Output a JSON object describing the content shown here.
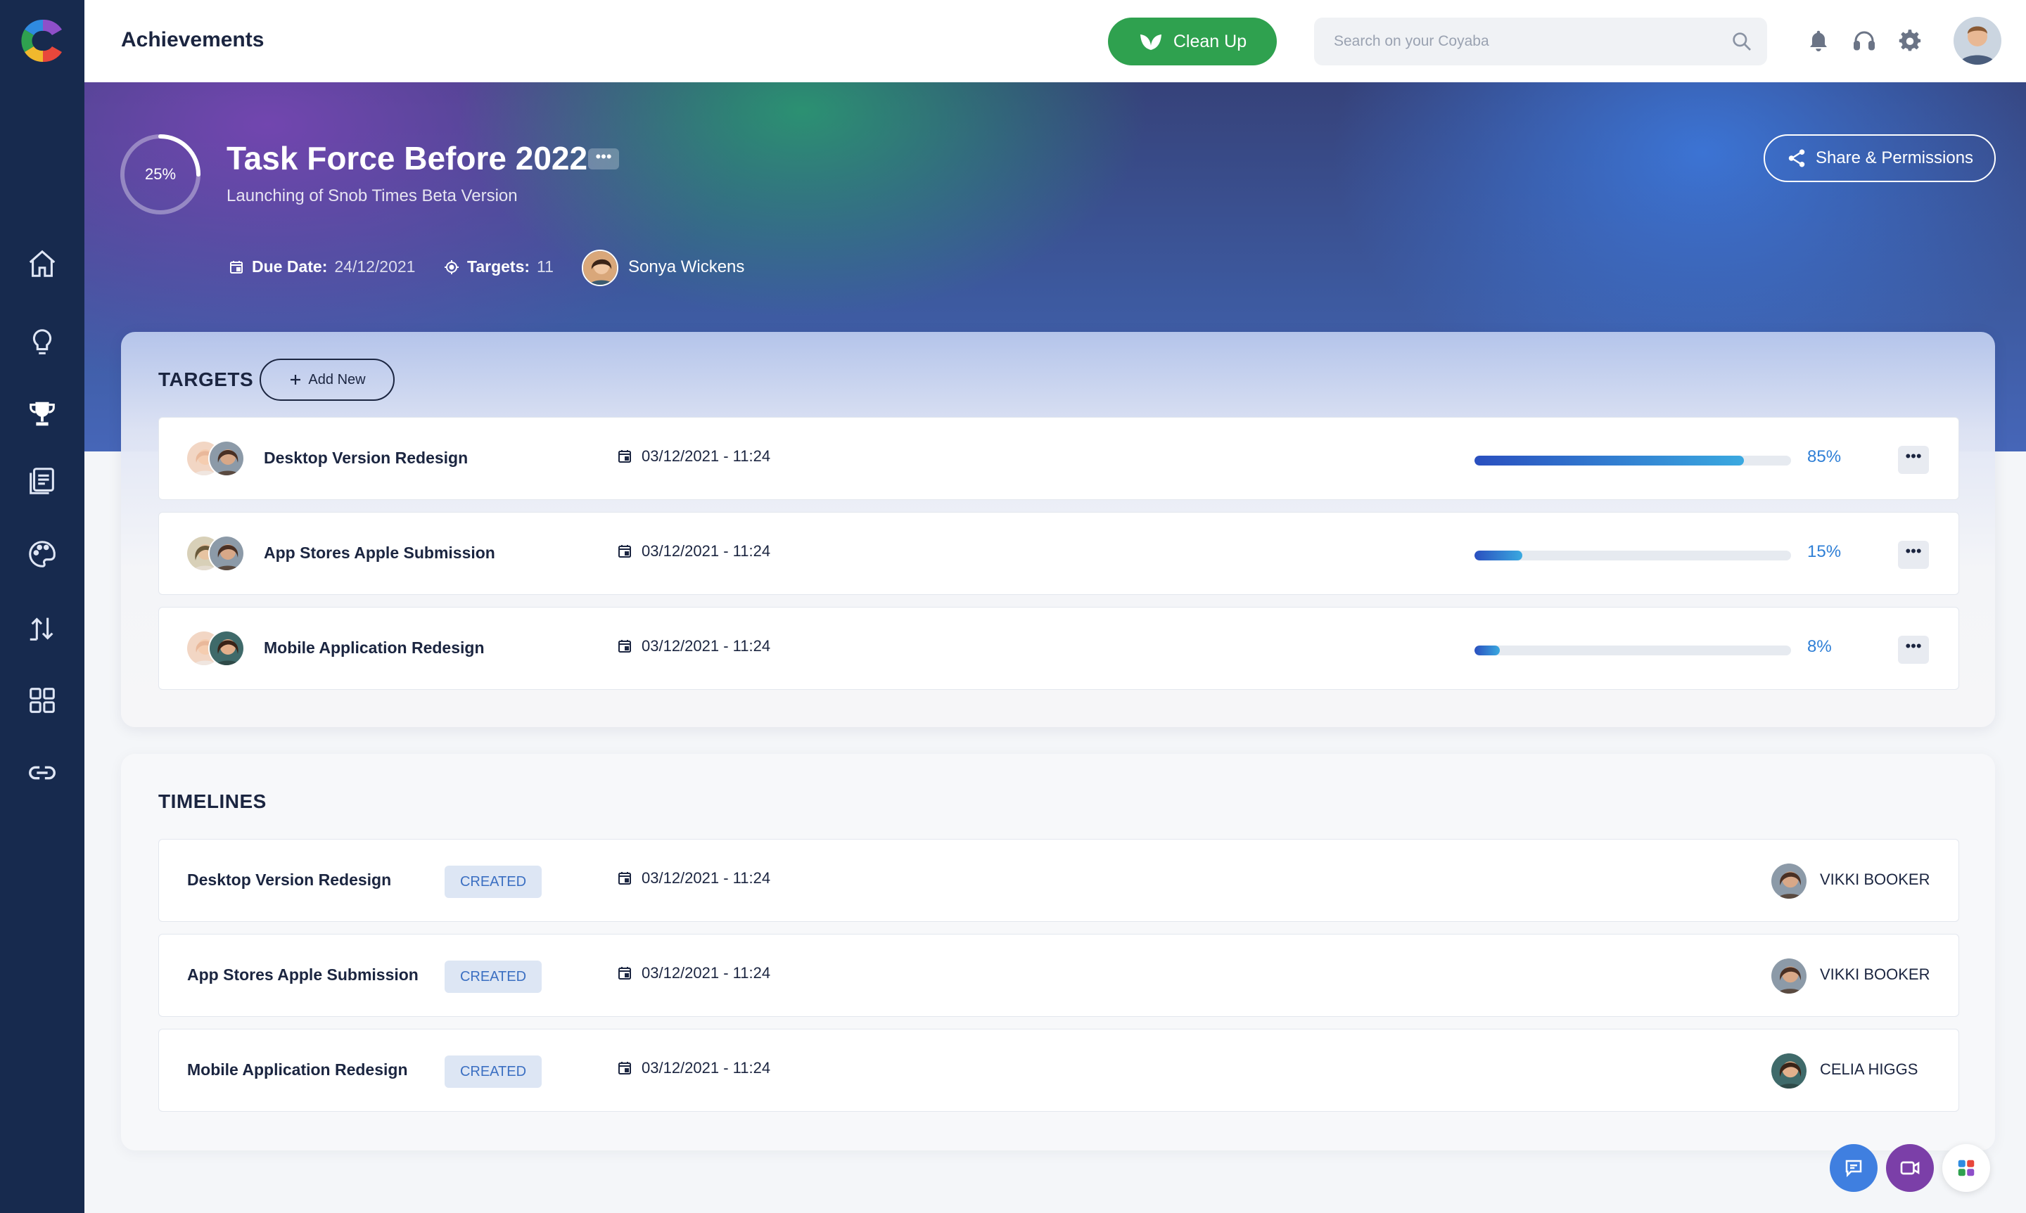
{
  "header": {
    "title": "Achievements",
    "cleanup_label": "Clean Up",
    "search_placeholder": "Search on your Coyaba"
  },
  "sidebar": {
    "items": [
      {
        "name": "home-icon"
      },
      {
        "name": "lightbulb-icon"
      },
      {
        "name": "trophy-icon"
      },
      {
        "name": "document-icon"
      },
      {
        "name": "palette-icon"
      },
      {
        "name": "transfer-icon"
      },
      {
        "name": "grid-icon"
      },
      {
        "name": "link-icon"
      }
    ]
  },
  "project": {
    "progress_label": "25%",
    "progress": 0.25,
    "title": "Task Force Before 2022",
    "more_label": "•••",
    "subtitle": "Launching of Snob Times Beta Version",
    "share_label": "Share & Permissions",
    "due_label": "Due Date:",
    "due_value": "24/12/2021",
    "targets_label": "Targets:",
    "targets_value": "11",
    "owner": "Sonya Wickens"
  },
  "targets": {
    "title": "TARGETS",
    "add_label": "Add New",
    "more_label": "•••",
    "rows": [
      {
        "name": "Desktop Version Redesign",
        "date": "03/12/2021 - 11:24",
        "progress": 0.85,
        "pct": "85%"
      },
      {
        "name": "App Stores Apple Submission",
        "date": "03/12/2021 - 11:24",
        "progress": 0.15,
        "pct": "15%"
      },
      {
        "name": "Mobile Application Redesign",
        "date": "03/12/2021 - 11:24",
        "progress": 0.08,
        "pct": "8%"
      }
    ]
  },
  "timelines": {
    "title": "TIMELINES",
    "rows": [
      {
        "name": "Desktop Version Redesign",
        "status": "CREATED",
        "date": "03/12/2021 - 11:24",
        "assignee": "VIKKI BOOKER"
      },
      {
        "name": "App Stores Apple Submission",
        "status": "CREATED",
        "date": "03/12/2021 - 11:24",
        "assignee": "VIKKI BOOKER"
      },
      {
        "name": "Mobile Application Redesign",
        "status": "CREATED",
        "date": "03/12/2021 - 11:24",
        "assignee": "CELIA HIGGS"
      }
    ]
  },
  "colors": {
    "sidebar": "#172a4e",
    "accent_green": "#2fa14f",
    "progress_blue": "#2f7fd6",
    "chat_button": "#3f7fe0",
    "video_button": "#7b3fa8"
  }
}
